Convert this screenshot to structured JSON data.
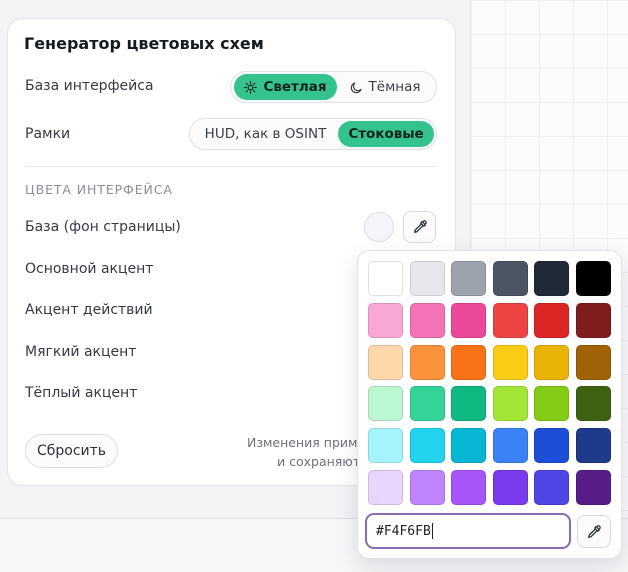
{
  "panel": {
    "title": "Генератор цветовых схем",
    "interface_base": {
      "label": "База интерфейса",
      "options": [
        {
          "label": "Светлая",
          "icon": "sun-icon",
          "active": true
        },
        {
          "label": "Тёмная",
          "icon": "moon-icon",
          "active": false
        }
      ]
    },
    "frames": {
      "label": "Рамки",
      "options": [
        {
          "label": "HUD, как в OSINT",
          "active": false
        },
        {
          "label": "Стоковые",
          "active": true
        }
      ]
    },
    "section_title": "ЦВЕТА ИНТЕРФЕЙСА",
    "color_rows": [
      {
        "label": "База (фон страницы)",
        "value": "#F4F6FB"
      },
      {
        "label": "Основной акцент"
      },
      {
        "label": "Акцент действий"
      },
      {
        "label": "Мягкий акцент"
      },
      {
        "label": "Тёплый акцент"
      }
    ],
    "reset_label": "Сбросить",
    "note_line1": "Изменения приме",
    "note_line2": "и сохраняют"
  },
  "picker": {
    "palette": [
      [
        "#FFFFFF",
        "#E5E7EB",
        "#9CA3AF",
        "#4B5563",
        "#1F2937",
        "#000000"
      ],
      [
        "#F9A8D4",
        "#F472B6",
        "#EC4899",
        "#EF4444",
        "#DC2626",
        "#7F1D1D"
      ],
      [
        "#FED7AA",
        "#FB923C",
        "#F97316",
        "#FACC15",
        "#EAB308",
        "#A16207"
      ],
      [
        "#BBF7D0",
        "#34D399",
        "#10B981",
        "#A3E635",
        "#84CC16",
        "#3F6212"
      ],
      [
        "#A5F3FC",
        "#22D3EE",
        "#06B6D4",
        "#3B82F6",
        "#1D4ED8",
        "#1E3A8A"
      ],
      [
        "#E9D5FF",
        "#C084FC",
        "#A855F7",
        "#7C3AED",
        "#4F46E5",
        "#581C87"
      ]
    ],
    "hex_value": "#F4F6FB",
    "eyedropper_icon": "eyedropper-icon"
  },
  "colors": {
    "accent": "#34C38F",
    "input_focus": "#8A6BB3"
  }
}
